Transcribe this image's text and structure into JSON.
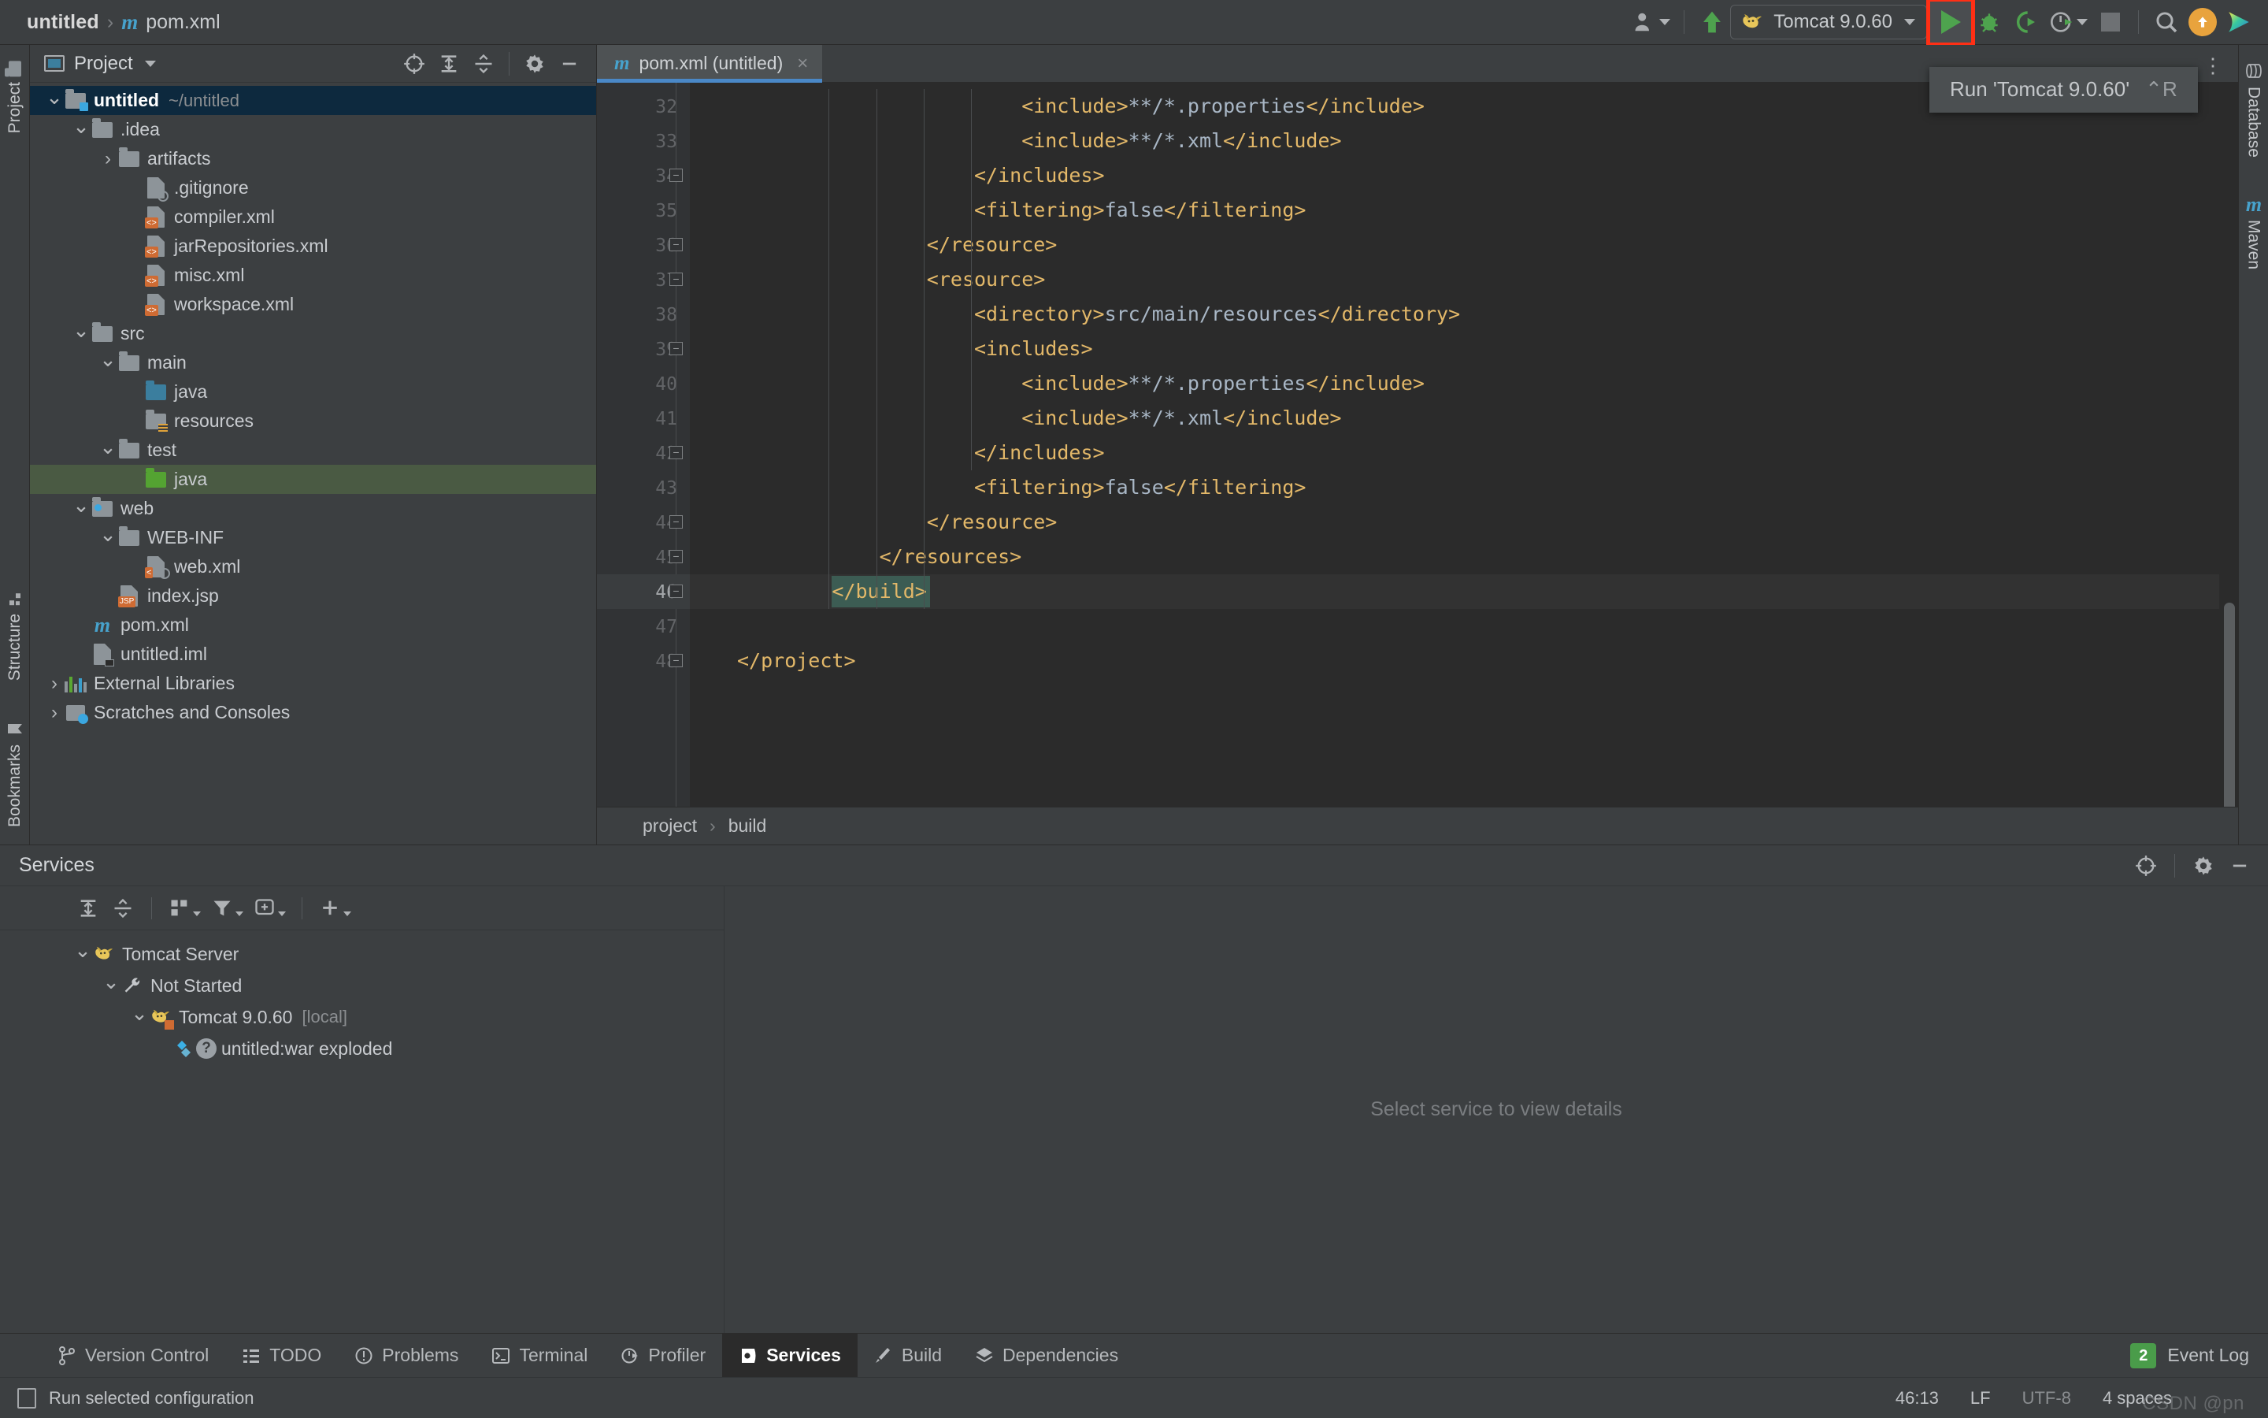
{
  "window": {
    "breadcrumb": {
      "project": "untitled",
      "separator": "›",
      "maven_glyph": "m",
      "file": "pom.xml"
    }
  },
  "toolbar": {
    "run_config_label": "Tomcat 9.0.60",
    "icons": {
      "user": "user-icon",
      "caret": "chevron-down-icon",
      "updates": "update-arrow-icon",
      "run": "run-icon",
      "debug": "debug-bug-icon",
      "run_coverage": "run-with-coverage-icon",
      "profiler": "profiler-icon",
      "stop": "stop-icon",
      "search": "search-icon",
      "upload": "upload-icon",
      "ide_logo": "ide-logo-icon"
    }
  },
  "tooltip": {
    "text": "Run 'Tomcat 9.0.60'",
    "shortcut": "⌃R"
  },
  "left_rail": {
    "items": [
      {
        "label": "Project"
      },
      {
        "label": "Structure"
      },
      {
        "label": "Bookmarks"
      }
    ]
  },
  "right_rail": {
    "items": [
      {
        "label": "Database"
      },
      {
        "label": "Maven"
      }
    ]
  },
  "project_panel": {
    "title": "Project",
    "toolbar": [
      {
        "name": "locate-icon"
      },
      {
        "name": "expand-all-icon"
      },
      {
        "name": "collapse-all-icon"
      },
      {
        "name": "gear-icon"
      },
      {
        "name": "hide-icon"
      }
    ],
    "tree": [
      {
        "depth": 0,
        "chevron": "down",
        "icon": "module-folder",
        "label": "untitled",
        "bold": true,
        "path": "~/untitled",
        "state": "selected-blue"
      },
      {
        "depth": 1,
        "chevron": "down",
        "icon": "folder",
        "label": ".idea"
      },
      {
        "depth": 2,
        "chevron": "right",
        "icon": "folder",
        "label": "artifacts"
      },
      {
        "depth": 3,
        "chevron": "",
        "icon": "file-ignored",
        "label": ".gitignore"
      },
      {
        "depth": 3,
        "chevron": "",
        "icon": "file-xml",
        "label": "compiler.xml"
      },
      {
        "depth": 3,
        "chevron": "",
        "icon": "file-xml",
        "label": "jarRepositories.xml"
      },
      {
        "depth": 3,
        "chevron": "",
        "icon": "file-xml",
        "label": "misc.xml"
      },
      {
        "depth": 3,
        "chevron": "",
        "icon": "file-xml",
        "label": "workspace.xml"
      },
      {
        "depth": 1,
        "chevron": "down",
        "icon": "folder",
        "label": "src"
      },
      {
        "depth": 2,
        "chevron": "down",
        "icon": "folder",
        "label": "main"
      },
      {
        "depth": 3,
        "chevron": "",
        "icon": "folder-source",
        "label": "java"
      },
      {
        "depth": 3,
        "chevron": "",
        "icon": "folder-resources",
        "label": "resources"
      },
      {
        "depth": 2,
        "chevron": "down",
        "icon": "folder",
        "label": "test"
      },
      {
        "depth": 3,
        "chevron": "",
        "icon": "folder-test",
        "label": "java",
        "state": "selected-green"
      },
      {
        "depth": 1,
        "chevron": "down",
        "icon": "folder-web",
        "label": "web"
      },
      {
        "depth": 2,
        "chevron": "down",
        "icon": "folder",
        "label": "WEB-INF"
      },
      {
        "depth": 3,
        "chevron": "",
        "icon": "file-webxml",
        "label": "web.xml"
      },
      {
        "depth": 2,
        "chevron": "",
        "icon": "file-jsp",
        "label": "index.jsp"
      },
      {
        "depth": 1,
        "chevron": "",
        "icon": "file-maven",
        "label": "pom.xml"
      },
      {
        "depth": 1,
        "chevron": "",
        "icon": "file-iml",
        "label": "untitled.iml"
      },
      {
        "depth": 0,
        "chevron": "right",
        "icon": "libraries",
        "label": "External Libraries"
      },
      {
        "depth": 0,
        "chevron": "right",
        "icon": "scratches",
        "label": "Scratches and Consoles"
      }
    ]
  },
  "editor": {
    "tab": {
      "label": "pom.xml (untitled)",
      "close": "×",
      "icon": "maven-file-icon"
    },
    "breadcrumb": [
      "project",
      "build"
    ],
    "breadcrumb_separator": "›",
    "first_line_number": 32,
    "caret_position": "46:13",
    "lines": [
      {
        "n": 32,
        "indent": 6,
        "tokens": [
          {
            "t": "tag",
            "s": "<include>"
          },
          {
            "t": "val",
            "s": "**/*.properties"
          },
          {
            "t": "tag",
            "s": "</include>"
          }
        ]
      },
      {
        "n": 33,
        "indent": 6,
        "tokens": [
          {
            "t": "tag",
            "s": "<include>"
          },
          {
            "t": "val",
            "s": "**/*.xml"
          },
          {
            "t": "tag",
            "s": "</include>"
          }
        ]
      },
      {
        "n": 34,
        "indent": 5,
        "tokens": [
          {
            "t": "tag",
            "s": "</includes>"
          }
        ],
        "fold": "end"
      },
      {
        "n": 35,
        "indent": 5,
        "tokens": [
          {
            "t": "tag",
            "s": "<filtering>"
          },
          {
            "t": "val",
            "s": "false"
          },
          {
            "t": "tag",
            "s": "</filtering>"
          }
        ]
      },
      {
        "n": 36,
        "indent": 4,
        "tokens": [
          {
            "t": "tag",
            "s": "</resource>"
          }
        ],
        "fold": "end"
      },
      {
        "n": 37,
        "indent": 4,
        "tokens": [
          {
            "t": "tag",
            "s": "<resource>"
          }
        ],
        "fold": "start"
      },
      {
        "n": 38,
        "indent": 5,
        "tokens": [
          {
            "t": "tag",
            "s": "<directory>"
          },
          {
            "t": "val",
            "s": "src/main/resources"
          },
          {
            "t": "tag",
            "s": "</directory>"
          }
        ]
      },
      {
        "n": 39,
        "indent": 5,
        "tokens": [
          {
            "t": "tag",
            "s": "<includes>"
          }
        ],
        "fold": "start"
      },
      {
        "n": 40,
        "indent": 6,
        "tokens": [
          {
            "t": "tag",
            "s": "<include>"
          },
          {
            "t": "val",
            "s": "**/*.properties"
          },
          {
            "t": "tag",
            "s": "</include>"
          }
        ]
      },
      {
        "n": 41,
        "indent": 6,
        "tokens": [
          {
            "t": "tag",
            "s": "<include>"
          },
          {
            "t": "val",
            "s": "**/*.xml"
          },
          {
            "t": "tag",
            "s": "</include>"
          }
        ]
      },
      {
        "n": 42,
        "indent": 5,
        "tokens": [
          {
            "t": "tag",
            "s": "</includes>"
          }
        ],
        "fold": "end"
      },
      {
        "n": 43,
        "indent": 5,
        "tokens": [
          {
            "t": "tag",
            "s": "<filtering>"
          },
          {
            "t": "val",
            "s": "false"
          },
          {
            "t": "tag",
            "s": "</filtering>"
          }
        ]
      },
      {
        "n": 44,
        "indent": 4,
        "tokens": [
          {
            "t": "tag",
            "s": "</resource>"
          }
        ],
        "fold": "end"
      },
      {
        "n": 45,
        "indent": 3,
        "tokens": [
          {
            "t": "tag",
            "s": "</resources>"
          }
        ],
        "fold": "end"
      },
      {
        "n": 46,
        "indent": 2,
        "tokens": [
          {
            "t": "tag",
            "s": "</build>"
          }
        ],
        "fold": "end",
        "bulb": true,
        "current": true,
        "caret_highlight": true
      },
      {
        "n": 47,
        "indent": 0,
        "tokens": []
      },
      {
        "n": 48,
        "indent": 0,
        "tokens": [
          {
            "t": "tag",
            "s": "</project>"
          }
        ],
        "fold": "end"
      }
    ]
  },
  "services": {
    "title": "Services",
    "toolbar": [
      {
        "name": "expand-all-icon"
      },
      {
        "name": "collapse-all-icon"
      },
      {
        "name": "group-by-icon"
      },
      {
        "name": "filter-icon"
      },
      {
        "name": "add-tab-icon"
      },
      {
        "name": "add-service-icon"
      }
    ],
    "head_icons": [
      {
        "name": "locate-icon"
      },
      {
        "name": "gear-icon"
      },
      {
        "name": "hide-icon"
      }
    ],
    "tree": [
      {
        "depth": 0,
        "chevron": "down",
        "icon": "tomcat-icon",
        "label": "Tomcat Server"
      },
      {
        "depth": 1,
        "chevron": "down",
        "icon": "wrench-icon",
        "label": "Not Started"
      },
      {
        "depth": 2,
        "chevron": "down",
        "icon": "tomcat-stopped-icon",
        "label": "Tomcat 9.0.60",
        "suffix": "[local]"
      },
      {
        "depth": 3,
        "chevron": "",
        "icon": "artifact-unknown-icon",
        "label": "untitled:war exploded"
      }
    ],
    "empty_detail": "Select service to view details"
  },
  "tool_window_bar": {
    "items": [
      {
        "label": "Version Control",
        "icon": "branch-icon",
        "active": false
      },
      {
        "label": "TODO",
        "icon": "todo-list-icon",
        "active": false
      },
      {
        "label": "Problems",
        "icon": "problems-icon",
        "active": false
      },
      {
        "label": "Terminal",
        "icon": "terminal-icon",
        "active": false
      },
      {
        "label": "Profiler",
        "icon": "profiler-icon",
        "active": false
      },
      {
        "label": "Services",
        "icon": "services-icon",
        "active": true
      },
      {
        "label": "Build",
        "icon": "build-hammer-icon",
        "active": false
      },
      {
        "label": "Dependencies",
        "icon": "dependencies-icon",
        "active": false
      }
    ],
    "event_log": {
      "label": "Event Log",
      "count": "2"
    }
  },
  "status_bar": {
    "message": "Run selected configuration",
    "caret": "46:13",
    "line_separator": "LF",
    "encoding": "UTF-8",
    "indent": "4 spaces",
    "watermark": "CSDN @pn"
  },
  "colors": {
    "accent_blue": "#4a88c7",
    "run_green": "#4ea34e",
    "highlight_red": "#ff2f15",
    "selection_blue": "#0d293e",
    "selection_green": "#4a5a43",
    "xml_tag": "#e3b869",
    "xml_value": "#a9b7c6"
  }
}
